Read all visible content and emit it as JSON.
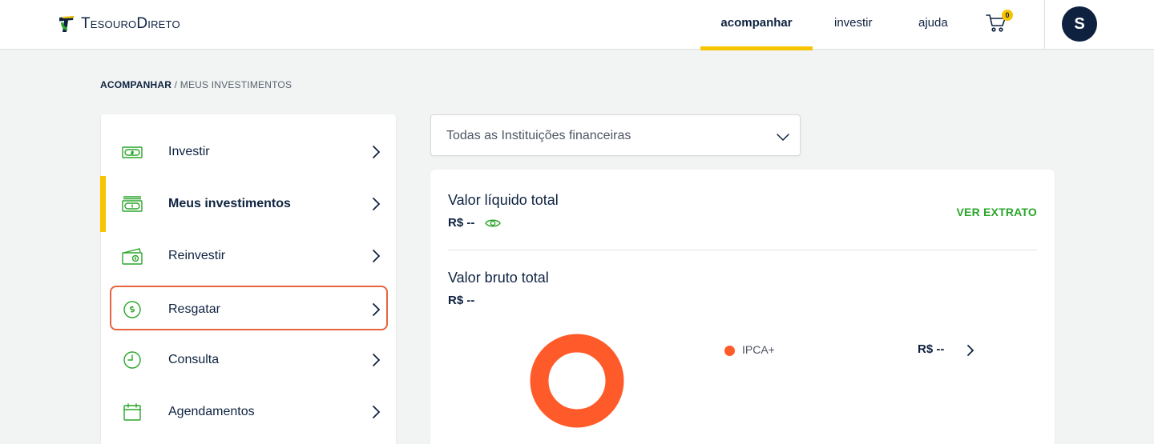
{
  "brand": {
    "logo_text": "TesouroDireto",
    "primary": "#0e2240",
    "accent_yellow": "#f6c400",
    "accent_green": "#2aa52a",
    "focus_orange": "#e8643c"
  },
  "header": {
    "nav": [
      {
        "label": "acompanhar",
        "active": true
      },
      {
        "label": "investir",
        "active": false
      },
      {
        "label": "ajuda",
        "active": false
      }
    ],
    "cart_count": "0",
    "avatar_initial": "S"
  },
  "breadcrumb": {
    "parent": "ACOMPANHAR",
    "separator": "/",
    "current": "MEUS INVESTIMENTOS"
  },
  "sidebar": {
    "items": [
      {
        "label": "Investir",
        "icon": "cash-icon"
      },
      {
        "label": "Meus investimentos",
        "icon": "cash-stack-icon",
        "active": true
      },
      {
        "label": "Reinvestir",
        "icon": "cash-return-icon"
      },
      {
        "label": "Resgatar",
        "icon": "coin-dollar-icon",
        "focused": true
      },
      {
        "label": "Consulta",
        "icon": "clock-icon"
      },
      {
        "label": "Agendamentos",
        "icon": "calendar-icon"
      }
    ]
  },
  "filter": {
    "selected": "Todas as Instituições financeiras"
  },
  "summary": {
    "liquido_title": "Valor líquido total",
    "liquido_value": "R$ --",
    "ver_extrato": "VER EXTRATO",
    "bruto_title": "Valor bruto total",
    "bruto_value": "R$ --"
  },
  "chart_data": {
    "type": "pie",
    "categories": [
      "IPCA+"
    ],
    "values": [
      1
    ],
    "value_labels": [
      "R$ --"
    ],
    "colors": [
      "#ff5a2a"
    ]
  }
}
